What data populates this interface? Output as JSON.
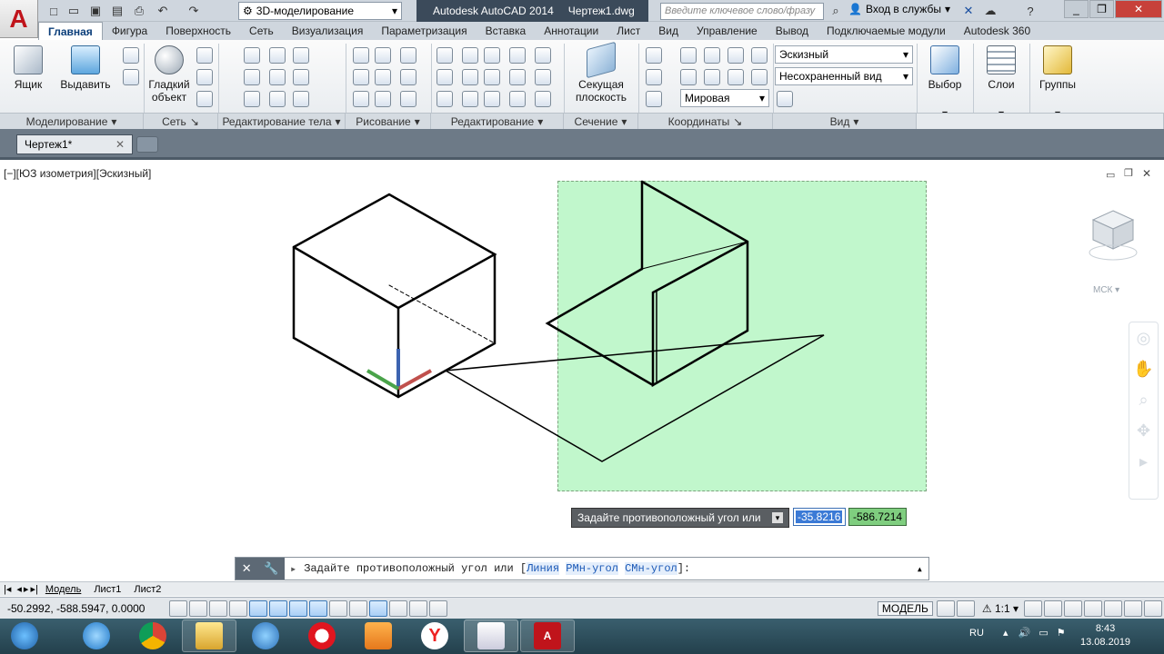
{
  "titlebar": {
    "workspace": "3D-моделирование",
    "product": "Autodesk AutoCAD 2014",
    "drawing": "Чертеж1.dwg",
    "search_placeholder": "Введите ключевое слово/фразу",
    "login": "Вход в службы"
  },
  "tabs": [
    "Главная",
    "Фигура",
    "Поверхность",
    "Сеть",
    "Визуализация",
    "Параметризация",
    "Вставка",
    "Аннотации",
    "Лист",
    "Вид",
    "Управление",
    "Вывод",
    "Подключаемые модули",
    "Autodesk 360"
  ],
  "ribbon": {
    "box": "Ящик",
    "extrude": "Выдавить",
    "smooth": "Гладкий объект",
    "section_plane": "Секущая плоскость",
    "visual_style": "Эскизный",
    "view": "Несохраненный вид",
    "ucs": "Мировая",
    "selection": "Выбор",
    "layers": "Слои",
    "groups": "Группы",
    "panels": [
      "Моделирование",
      "Сеть",
      "Редактирование тела",
      "Рисование",
      "Редактирование",
      "Сечение",
      "Координаты",
      "Вид"
    ]
  },
  "filetab": "Чертеж1*",
  "viewport": {
    "label": "[−][ЮЗ изометрия][Эскизный]",
    "ucs_label": "МСК",
    "prompt": "Задайте противоположный угол или",
    "input1": "-35.8216",
    "input2": "-586.7214"
  },
  "cmdline": {
    "text_prefix": "Задайте противоположный угол или [",
    "opt1": "Линия",
    "opt2": "РМн-угол",
    "opt3": "СМн-угол",
    "text_suffix": "]:"
  },
  "layouttabs": [
    "Модель",
    "Лист1",
    "Лист2"
  ],
  "status": {
    "coords": "-50.2992, -588.5947, 0.0000",
    "model": "МОДЕЛЬ",
    "scale": "1:1"
  },
  "tray": {
    "lang": "RU",
    "time": "8:43",
    "date": "13.08.2019"
  }
}
